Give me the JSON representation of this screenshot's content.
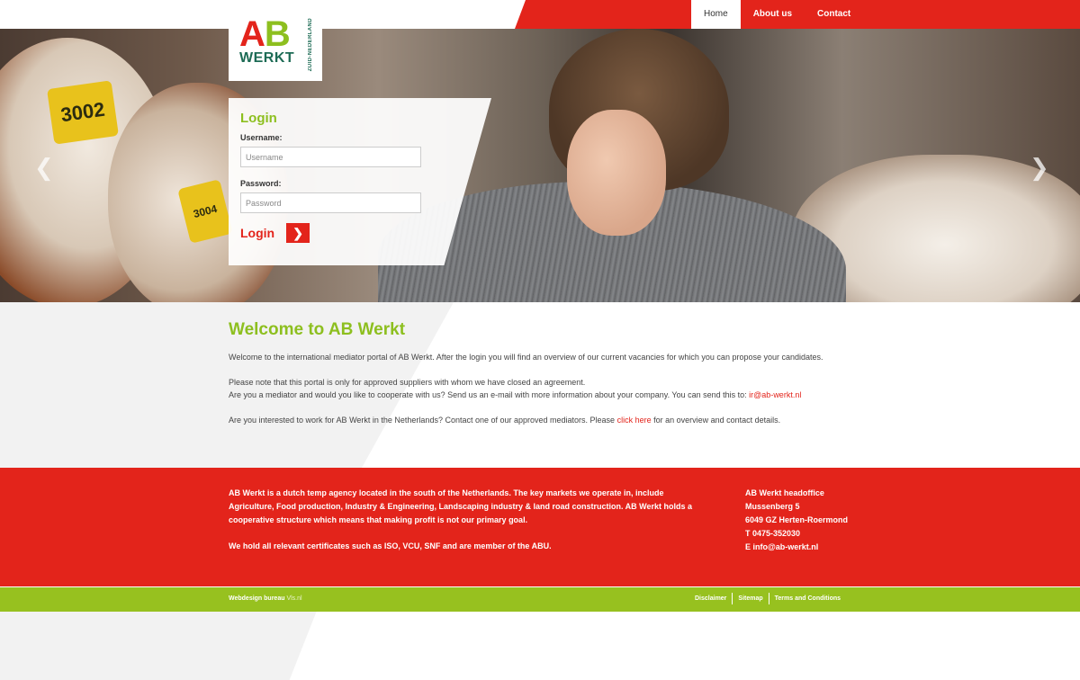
{
  "nav": {
    "items": [
      {
        "label": "Home",
        "active": true
      },
      {
        "label": "About us",
        "active": false
      },
      {
        "label": "Contact",
        "active": false
      }
    ]
  },
  "logo": {
    "ab_a": "A",
    "ab_b": "B",
    "werkt": "WERKT",
    "region": "ZUID-NEDERLAND"
  },
  "hero": {
    "tag1": "3002",
    "tag2": "3004",
    "prev_icon": "chevron-left-icon",
    "next_icon": "chevron-right-icon"
  },
  "login": {
    "title": "Login",
    "username_label": "Username:",
    "username_placeholder": "Username",
    "password_label": "Password:",
    "password_placeholder": "Password",
    "submit_label": "Login",
    "submit_icon": "chevron-right-icon"
  },
  "welcome": {
    "title": "Welcome to AB Werkt",
    "p1": "Welcome to the international mediator portal of AB Werkt. After the login you will find an overview of our current vacancies for which you can propose your candidates.",
    "p2_line1": "Please note that this portal is only for approved suppliers with whom we have closed an agreement.",
    "p2_line2": "Are you a mediator and would you like to cooperate with us? Send us an e-mail with more information about your company. You can send this to: ",
    "p2_email": "ir@ab-werkt.nl",
    "p3_before": "Are you interested to work for AB Werkt in the Netherlands? Contact one of our approved mediators. Please ",
    "p3_link": "click here",
    "p3_after": " for an overview and contact details."
  },
  "footer": {
    "about": "AB Werkt is a dutch temp agency located in the south of the Netherlands. The key markets we operate in, include Agriculture, Food production, Industry & Engineering, Landscaping industry & land road construction. AB Werkt holds a cooperative structure which means that making profit is not our primary goal.",
    "certs": "We hold all relevant certificates such as ISO, VCU, SNF and are member of the ABU.",
    "office_title": "AB Werkt headoffice",
    "street": "Mussenberg 5",
    "city": "6049 GZ Herten-Roermond",
    "phone": "T 0475-352030",
    "email_prefix": "E ",
    "email": "info@ab-werkt.nl"
  },
  "bottombar": {
    "credit": "Webdesign bureau ",
    "credit_link": "Vls.nl",
    "links": [
      "Disclaimer",
      "Sitemap",
      "Terms and Conditions"
    ]
  },
  "colors": {
    "red": "#e3241b",
    "green": "#8dbf1f",
    "dark_green": "#1d6b55",
    "bar_green": "#97c11f"
  }
}
